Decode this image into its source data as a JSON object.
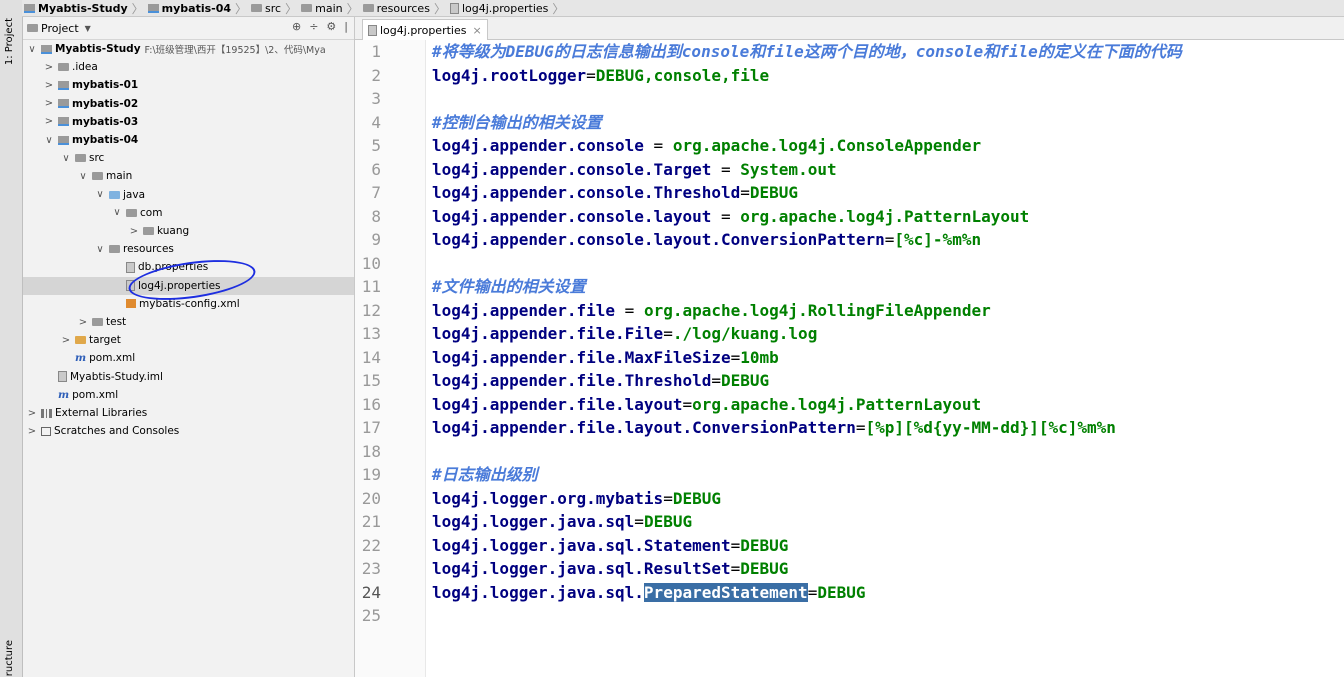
{
  "breadcrumb": {
    "items": [
      "Myabtis-Study",
      "mybatis-04",
      "src",
      "main",
      "resources",
      "log4j.properties"
    ]
  },
  "sidebar": {
    "vtab_project": "1: Project",
    "vtab_structure": "ructure"
  },
  "project": {
    "header_label": "Project",
    "header_icons": [
      "⊕",
      "÷",
      "⚙",
      "|"
    ],
    "tree": [
      {
        "label": "Myabtis-Study",
        "extra": "F:\\班级管理\\西开【19525】\\2、代码\\Mya",
        "type": "module",
        "arrow": "∨",
        "level": 0,
        "bold": true
      },
      {
        "label": ".idea",
        "type": "folder",
        "arrow": ">",
        "level": 1
      },
      {
        "label": "mybatis-01",
        "type": "module",
        "arrow": ">",
        "level": 1,
        "bold": true
      },
      {
        "label": "mybatis-02",
        "type": "module",
        "arrow": ">",
        "level": 1,
        "bold": true
      },
      {
        "label": "mybatis-03",
        "type": "module",
        "arrow": ">",
        "level": 1,
        "bold": true
      },
      {
        "label": "mybatis-04",
        "type": "module",
        "arrow": "∨",
        "level": 1,
        "bold": true
      },
      {
        "label": "src",
        "type": "folder",
        "arrow": "∨",
        "level": 2
      },
      {
        "label": "main",
        "type": "folder",
        "arrow": "∨",
        "level": 3
      },
      {
        "label": "java",
        "type": "folder-blue",
        "arrow": "∨",
        "level": 4
      },
      {
        "label": "com",
        "type": "folder",
        "arrow": "∨",
        "level": 5
      },
      {
        "label": "kuang",
        "type": "folder",
        "arrow": ">",
        "level": 6
      },
      {
        "label": "resources",
        "type": "folder",
        "arrow": "∨",
        "level": 4
      },
      {
        "label": "db.properties",
        "type": "prop",
        "arrow": "",
        "level": 5
      },
      {
        "label": "log4j.properties",
        "type": "prop",
        "arrow": "",
        "level": 5,
        "selected": true
      },
      {
        "label": "mybatis-config.xml",
        "type": "xml",
        "arrow": "",
        "level": 5
      },
      {
        "label": "test",
        "type": "folder",
        "arrow": ">",
        "level": 3
      },
      {
        "label": "target",
        "type": "folder-orange",
        "arrow": ">",
        "level": 2
      },
      {
        "label": "pom.xml",
        "type": "maven",
        "arrow": "",
        "level": 2
      },
      {
        "label": "Myabtis-Study.iml",
        "type": "prop",
        "arrow": "",
        "level": 1
      },
      {
        "label": "pom.xml",
        "type": "maven",
        "arrow": "",
        "level": 1
      },
      {
        "label": "External Libraries",
        "type": "lib",
        "arrow": ">",
        "level": 0
      },
      {
        "label": "Scratches and Consoles",
        "type": "scratch",
        "arrow": ">",
        "level": 0
      }
    ]
  },
  "editor": {
    "tab_label": "log4j.properties",
    "tab_close": "×",
    "current_line": 24,
    "lines": [
      {
        "n": "1",
        "comment": "#将等级为DEBUG的日志信息输出到console和file这两个目的地，console和file的定义在下面的代码"
      },
      {
        "n": "2",
        "key": "log4j.rootLogger",
        "sep": "=",
        "val": "DEBUG,console,file"
      },
      {
        "n": "3"
      },
      {
        "n": "4",
        "comment": "#控制台输出的相关设置"
      },
      {
        "n": "5",
        "key": "log4j.appender.console",
        "sep": " = ",
        "val": "org.apache.log4j.ConsoleAppender"
      },
      {
        "n": "6",
        "key": "log4j.appender.console.Target",
        "sep": " = ",
        "val": "System.out"
      },
      {
        "n": "7",
        "key": "log4j.appender.console.Threshold",
        "sep": "=",
        "val": "DEBUG"
      },
      {
        "n": "8",
        "key": "log4j.appender.console.layout",
        "sep": " = ",
        "val": "org.apache.log4j.PatternLayout"
      },
      {
        "n": "9",
        "key": "log4j.appender.console.layout.ConversionPattern",
        "sep": "=",
        "val": "[%c]-%m%n"
      },
      {
        "n": "10"
      },
      {
        "n": "11",
        "comment": "#文件输出的相关设置"
      },
      {
        "n": "12",
        "key": "log4j.appender.file",
        "sep": " = ",
        "val": "org.apache.log4j.RollingFileAppender"
      },
      {
        "n": "13",
        "key": "log4j.appender.file.File",
        "sep": "=",
        "val": "./log/kuang.log"
      },
      {
        "n": "14",
        "key": "log4j.appender.file.MaxFileSize",
        "sep": "=",
        "val": "10mb"
      },
      {
        "n": "15",
        "key": "log4j.appender.file.Threshold",
        "sep": "=",
        "val": "DEBUG"
      },
      {
        "n": "16",
        "key": "log4j.appender.file.layout",
        "sep": "=",
        "val": "org.apache.log4j.PatternLayout"
      },
      {
        "n": "17",
        "key": "log4j.appender.file.layout.ConversionPattern",
        "sep": "=",
        "val": "[%p][%d{yy-MM-dd}][%c]%m%n"
      },
      {
        "n": "18"
      },
      {
        "n": "19",
        "comment": "#日志输出级别"
      },
      {
        "n": "20",
        "key": "log4j.logger.org.mybatis",
        "sep": "=",
        "val": "DEBUG"
      },
      {
        "n": "21",
        "key": "log4j.logger.java.sql",
        "sep": "=",
        "val": "DEBUG"
      },
      {
        "n": "22",
        "key": "log4j.logger.java.sql.Statement",
        "sep": "=",
        "val": "DEBUG"
      },
      {
        "n": "23",
        "key": "log4j.logger.java.sql.ResultSet",
        "sep": "=",
        "val": "DEBUG"
      },
      {
        "n": "24",
        "key_pre": "log4j.logger.java.sql.",
        "key_sel": "PreparedStatement",
        "sep": "=",
        "val": "DEBUG"
      },
      {
        "n": "25"
      }
    ]
  },
  "colors": {
    "key": "#000080",
    "value": "#008000",
    "comment": "#4a7bd9",
    "selection": "#3a6ea5",
    "annotation_circle": "#1d2ee0"
  }
}
